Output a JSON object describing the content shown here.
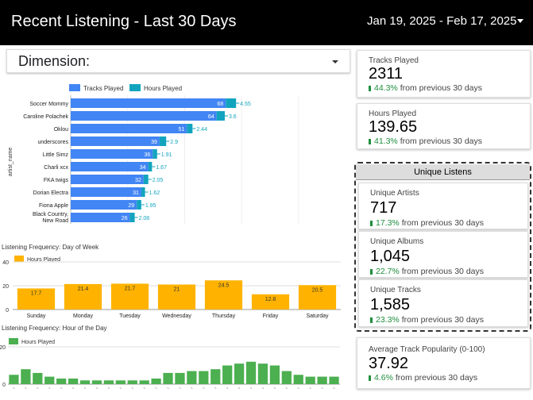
{
  "header": {
    "title": "Recent Listening - Last 30 Days",
    "date_range": "Jan 19, 2025 - Feb 17, 2025"
  },
  "dimension": {
    "label": "Dimension:"
  },
  "colors": {
    "tracks": "#4285f4",
    "hours": "#12a4bf",
    "day_bar": "#ffb300",
    "hour_bar": "#4caf50",
    "delta": "#1e8e3e"
  },
  "artist_chart": {
    "legend": {
      "tracks": "Tracks Played",
      "hours": "Hours Played"
    },
    "ylabel": "artist_name",
    "chart_data": {
      "type": "bar",
      "categories": [
        "Soccer Mommy",
        "Caroline Polachek",
        "Oklou",
        "underscores",
        "Little Simz",
        "Charli xcx",
        "FKA twigs",
        "Dorian Electra",
        "Fiona Apple",
        "Black Country, New Road"
      ],
      "series": [
        {
          "name": "Tracks Played",
          "values": [
            68,
            64,
            51,
            39,
            36,
            34,
            32,
            31,
            29,
            26
          ]
        },
        {
          "name": "Hours Played",
          "values": [
            4.55,
            3.6,
            2.44,
            2.9,
            1.91,
            1.67,
            2.05,
            1.62,
            1.95,
            2.08
          ]
        }
      ],
      "xlim": [
        0,
        115
      ]
    }
  },
  "day_chart": {
    "title": "Listening Frequency: Day of Week",
    "legend": "Hours Played",
    "chart_data": {
      "type": "bar",
      "categories": [
        "Sunday",
        "Monday",
        "Tuesday",
        "Wednesday",
        "Thursday",
        "Friday",
        "Saturday"
      ],
      "series": [
        {
          "name": "Hours Played",
          "values": [
            17.7,
            21.4,
            21.7,
            21,
            24.5,
            12.8,
            20.5
          ]
        }
      ],
      "yticks": [
        "0",
        "20",
        "40"
      ],
      "ylim": [
        0,
        40
      ]
    }
  },
  "hour_chart": {
    "title": "Listening Frequency: Hour of the Day",
    "legend": "Hours Played",
    "chart_data": {
      "type": "bar",
      "series": [
        {
          "name": "Hours Played",
          "values": [
            5,
            8,
            6,
            4,
            3,
            3,
            2,
            2,
            2,
            2,
            2,
            2,
            3,
            6,
            6,
            7,
            7,
            8,
            10,
            11,
            12,
            11,
            10,
            7,
            5,
            4,
            4,
            4
          ]
        }
      ],
      "yticks": [
        "0",
        "20"
      ],
      "ylim": [
        0,
        20
      ]
    }
  },
  "cards": {
    "tracks_played": {
      "label": "Tracks Played",
      "value": "2311",
      "pct": "44.3%",
      "suffix": " from previous 30 days"
    },
    "hours_played": {
      "label": "Hours Played",
      "value": "139.65",
      "pct": "41.3%",
      "suffix": " from previous 30 days"
    },
    "unique_listens": {
      "title": "Unique Listens"
    },
    "unique_artists": {
      "label": "Unique Artists",
      "value": "717",
      "pct": "17.3%",
      "suffix": " from previous 30 days"
    },
    "unique_albums": {
      "label": "Unique Albums",
      "value": "1,045",
      "pct": "22.7%",
      "suffix": " from previous 30 days"
    },
    "unique_tracks": {
      "label": "Unique Tracks",
      "value": "1,585",
      "pct": "23.3%",
      "suffix": " from previous 30 days"
    },
    "popularity": {
      "label": "Average Track Popularity (0-100)",
      "value": "37.92",
      "pct": "4.6%",
      "suffix": " from previous 30 days"
    }
  }
}
